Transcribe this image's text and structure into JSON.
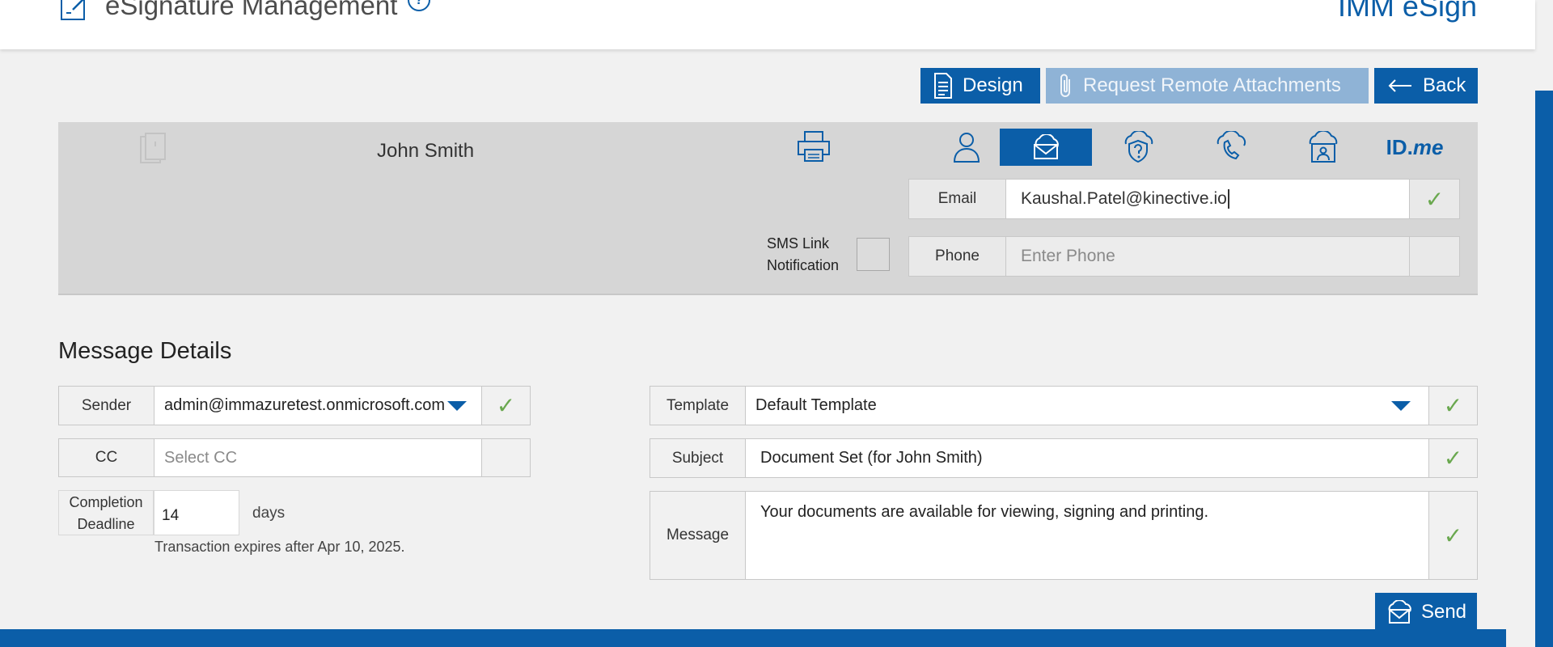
{
  "header": {
    "title": "eSignature Management",
    "help_icon": "help-circle-icon",
    "help_glyph": "?",
    "brand": "IMM eSign"
  },
  "toolbar": {
    "design_label": "Design",
    "attachments_label": "Request Remote Attachments",
    "back_label": "Back"
  },
  "recipient": {
    "name": "John Smith",
    "methods": [
      "person-icon",
      "cloud-email-icon",
      "shield-question-icon",
      "cloud-phone-icon",
      "cloud-id-icon",
      "idme-logo"
    ],
    "active_method": "cloud-email-icon",
    "idme_id": "ID.",
    "idme_me": "me",
    "email_label": "Email",
    "email_value": "Kaushal.Patel@kinective.io",
    "phone_label": "Phone",
    "phone_placeholder": "Enter Phone",
    "sms_line1": "SMS Link",
    "sms_line2": "Notification",
    "check_glyph": "✓"
  },
  "message_details": {
    "title": "Message Details",
    "sender_label": "Sender",
    "sender_value": "admin@immazuretest.onmicrosoft.com",
    "cc_label": "CC",
    "cc_placeholder": "Select CC",
    "deadline_line1": "Completion",
    "deadline_line2": "Deadline",
    "deadline_value": "14",
    "days_label": "days",
    "expires_text": "Transaction expires after Apr 10, 2025.",
    "template_label": "Template",
    "template_value": "Default Template",
    "subject_label": "Subject",
    "subject_value": "Document Set (for John Smith)",
    "message_label": "Message",
    "message_value": "Your documents are available for viewing, signing and printing.",
    "send_label": "Send"
  },
  "colors": {
    "primary": "#0b5ea8",
    "disabled": "#8fb3d6",
    "check": "#6aa84f",
    "panel": "#d6d6d6"
  }
}
